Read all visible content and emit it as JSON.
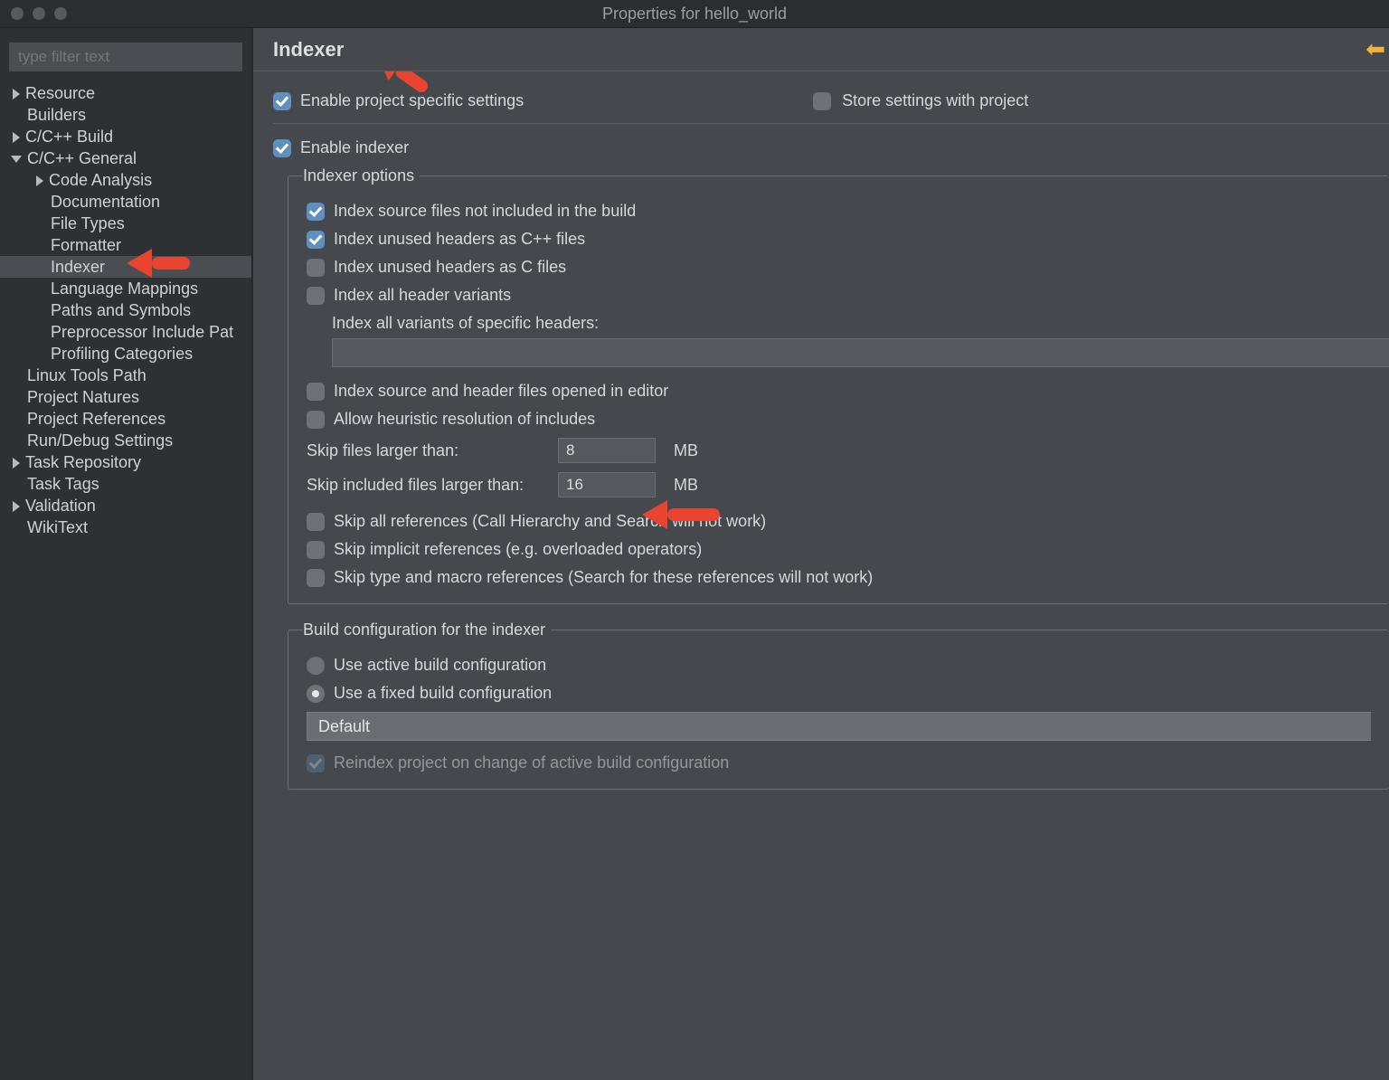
{
  "window": {
    "title": "Properties for hello_world"
  },
  "sidebar": {
    "filter_placeholder": "type filter text",
    "items": [
      {
        "label": "Resource"
      },
      {
        "label": "Builders"
      },
      {
        "label": "C/C++ Build"
      },
      {
        "label": "C/C++ General"
      },
      {
        "label": "Code Analysis"
      },
      {
        "label": "Documentation"
      },
      {
        "label": "File Types"
      },
      {
        "label": "Formatter"
      },
      {
        "label": "Indexer"
      },
      {
        "label": "Language Mappings"
      },
      {
        "label": "Paths and Symbols"
      },
      {
        "label": "Preprocessor Include Pat"
      },
      {
        "label": "Profiling Categories"
      },
      {
        "label": "Linux Tools Path"
      },
      {
        "label": "Project Natures"
      },
      {
        "label": "Project References"
      },
      {
        "label": "Run/Debug Settings"
      },
      {
        "label": "Task Repository"
      },
      {
        "label": "Task Tags"
      },
      {
        "label": "Validation"
      },
      {
        "label": "WikiText"
      }
    ]
  },
  "page": {
    "title": "Indexer",
    "enable_project_specific": "Enable project specific settings",
    "store_with_project": "Store settings with project",
    "enable_indexer": "Enable indexer",
    "group_indexer_options": "Indexer options",
    "opt_index_source_not_in_build": "Index source files not included in the build",
    "opt_index_unused_cpp": "Index unused headers as C++ files",
    "opt_index_unused_c": "Index unused headers as C files",
    "opt_index_all_header_variants": "Index all header variants",
    "opt_index_specific_headers": "Index all variants of specific headers:",
    "opt_index_opened": "Index source and header files opened in editor",
    "opt_allow_heuristic": "Allow heuristic resolution of includes",
    "skip_files_label": "Skip files larger than:",
    "skip_files_value": "8",
    "skip_files_unit": "MB",
    "skip_included_label": "Skip included files larger than:",
    "skip_included_value": "16",
    "skip_included_unit": "MB",
    "opt_skip_all_refs": "Skip all references (Call Hierarchy and Search will not work)",
    "opt_skip_implicit": "Skip implicit references (e.g. overloaded operators)",
    "opt_skip_type_macro": "Skip type and macro references (Search for these references will not work)",
    "group_build_config": "Build configuration for the indexer",
    "radio_active": "Use active build configuration",
    "radio_fixed": "Use a fixed build configuration",
    "select_default": "Default",
    "reindex_on_change": "Reindex project on change of active build configuration"
  }
}
